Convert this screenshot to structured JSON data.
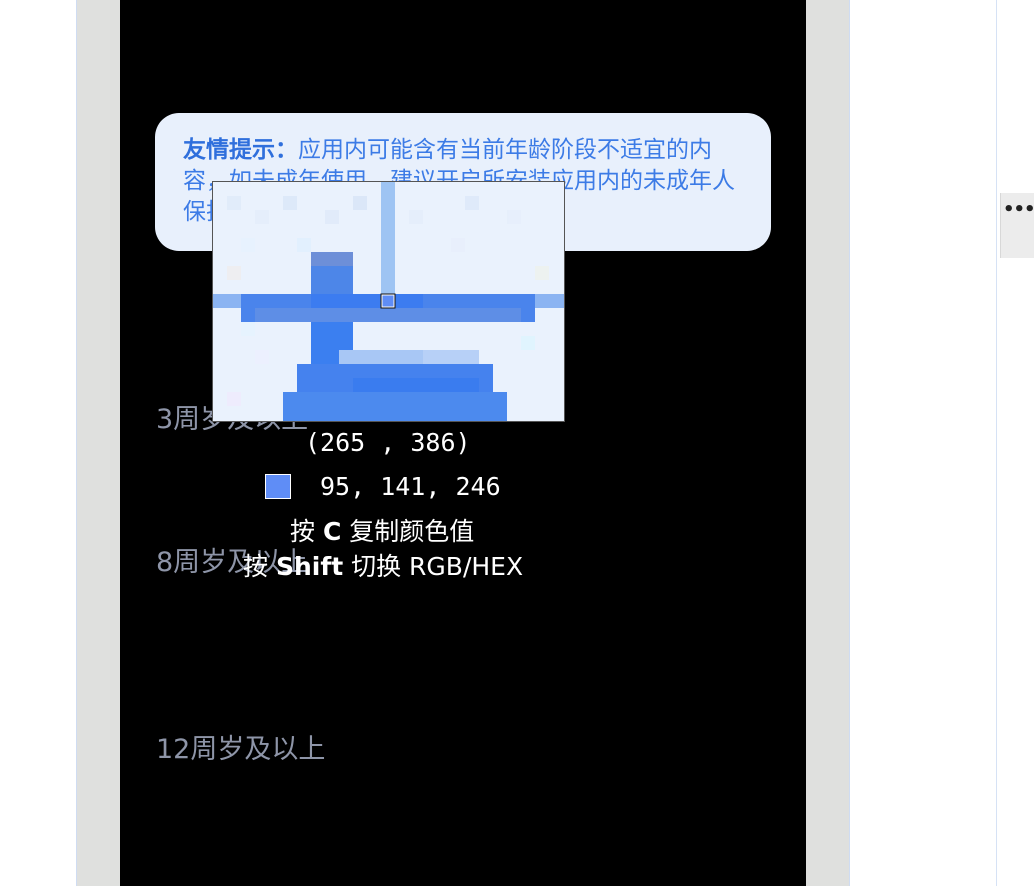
{
  "tip": {
    "title": "友情提示：",
    "body": "应用内可能含有当前年龄阶段不适宜的内容，如未成年使用，建议开启所安装应用内的未成年人保护模式。"
  },
  "age_options": [
    "3周岁及以上",
    "8周岁及以上",
    "12周岁及以上"
  ],
  "more_menu": {
    "label": "•••"
  },
  "color_picker": {
    "coords_text": "(265 , 386)",
    "rgb_text": "95, 141, 246",
    "swatch_color": "#5f8df6",
    "hint_copy": {
      "prefix": "按 ",
      "key": "C",
      "suffix": " 复制颜色值"
    },
    "hint_shift": {
      "prefix": "按 ",
      "key": "Shift",
      "suffix": " 切换 RGB/HEX"
    }
  },
  "colors": {
    "phone_bg": "#000000",
    "tip_bg": "#e8f0fc",
    "tip_text": "#3c7be6",
    "age_text": "#8e95a8"
  }
}
